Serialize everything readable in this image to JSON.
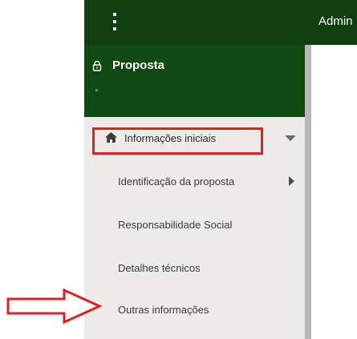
{
  "topbar": {
    "title": "Admin",
    "menu_icon": "kebab-menu-icon",
    "color": "#0f3f10"
  },
  "sidebar": {
    "header": {
      "title": "Proposta",
      "icon": "lock-icon",
      "color": "#0f4a12"
    },
    "items": [
      {
        "label": "Informações iniciais",
        "icon": "home-icon",
        "expanded": true
      },
      {
        "label": "Identificação da proposta"
      },
      {
        "label": "Responsabilidade Social"
      },
      {
        "label": "Detalhes técnicos"
      },
      {
        "label": "Outras informações"
      }
    ]
  },
  "annotations": {
    "highlight_color": "#e02020",
    "arrow_icon": "red-arrow-icon"
  }
}
